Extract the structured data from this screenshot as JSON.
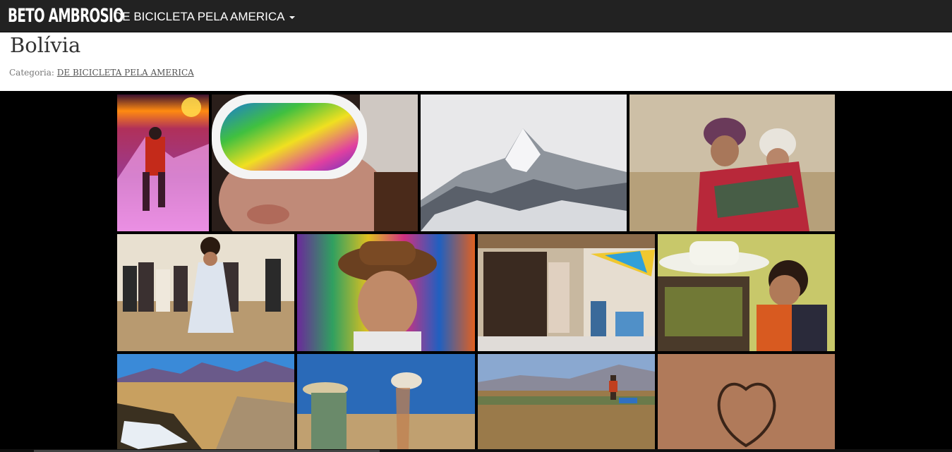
{
  "header": {
    "brand": "BETO AMBROSIO",
    "menu_label": "DE BICICLETA PELA AMERICA"
  },
  "page": {
    "title": "Bolívia",
    "category_label": "Categoria:",
    "category_link": "DE BICICLETA PELA AMERICA"
  },
  "gallery": {
    "photos": [
      {
        "subject": "climber at sunset on snowy summit"
      },
      {
        "subject": "close-up of face with reflective ski goggles"
      },
      {
        "subject": "snow-capped mountain peak"
      },
      {
        "subject": "woman carrying child in colorful shawl"
      },
      {
        "subject": "girl dancing in front of brass band"
      },
      {
        "subject": "girl in bowler hat with colorful blankets"
      },
      {
        "subject": "street shop with parasol and vendor"
      },
      {
        "subject": "woman in white hat with child"
      },
      {
        "subject": "altiplano road with snow and mountains"
      },
      {
        "subject": "woman winnowing quinoa"
      },
      {
        "subject": "person working in desert field"
      },
      {
        "subject": "heart drawn in sand"
      }
    ]
  }
}
